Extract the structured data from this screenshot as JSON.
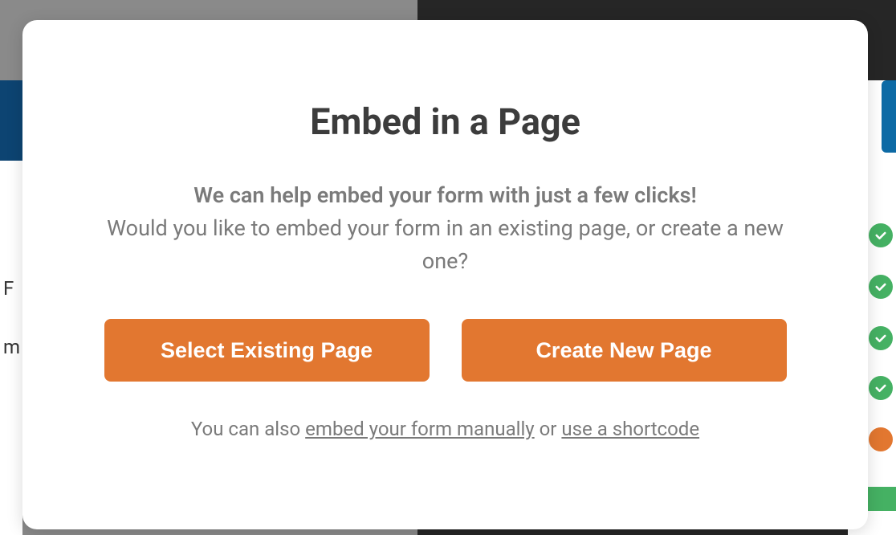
{
  "modal": {
    "title": "Embed in a Page",
    "subtitle": "We can help embed your form with just a few clicks!",
    "description": "Would you like to embed your form in an existing page, or create a new one?",
    "buttons": {
      "select_existing": "Select Existing Page",
      "create_new": "Create New Page"
    },
    "footer": {
      "prefix": "You can also ",
      "link_manual": "embed your form manually",
      "middle": " or ",
      "link_shortcode": "use a shortcode"
    }
  },
  "background": {
    "left_text_1": "F",
    "left_text_2": "m"
  },
  "colors": {
    "accent": "#e27730",
    "success": "#45b163",
    "text_dark": "#3c3c3c",
    "text_muted": "#7a7a7a"
  }
}
